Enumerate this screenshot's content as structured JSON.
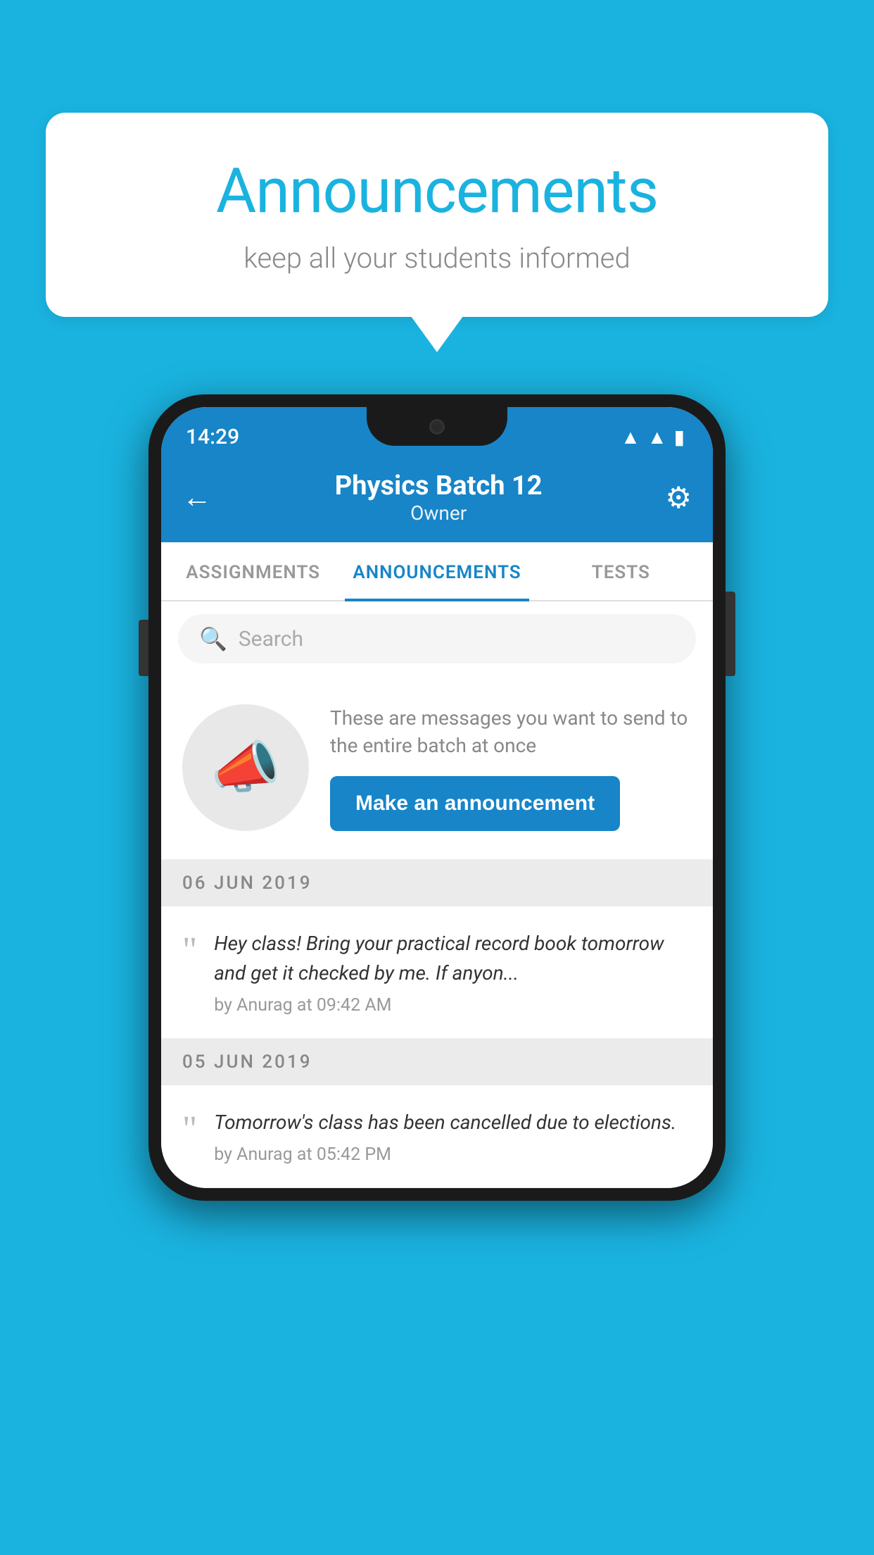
{
  "page": {
    "background_color": "#1ab3e0"
  },
  "speech_bubble": {
    "title": "Announcements",
    "subtitle": "keep all your students informed"
  },
  "status_bar": {
    "time": "14:29"
  },
  "app_header": {
    "title": "Physics Batch 12",
    "subtitle": "Owner",
    "back_label": "←",
    "settings_label": "⚙"
  },
  "tabs": [
    {
      "label": "ASSIGNMENTS",
      "active": false
    },
    {
      "label": "ANNOUNCEMENTS",
      "active": true
    },
    {
      "label": "TESTS",
      "active": false
    }
  ],
  "search": {
    "placeholder": "Search"
  },
  "promo": {
    "description": "These are messages you want to send to the entire batch at once",
    "button_label": "Make an announcement"
  },
  "announcements": [
    {
      "date": "06  JUN  2019",
      "text": "Hey class! Bring your practical record book tomorrow and get it checked by me. If anyon...",
      "meta": "by Anurag at 09:42 AM"
    },
    {
      "date": "05  JUN  2019",
      "text": "Tomorrow's class has been cancelled due to elections.",
      "meta": "by Anurag at 05:42 PM"
    }
  ]
}
